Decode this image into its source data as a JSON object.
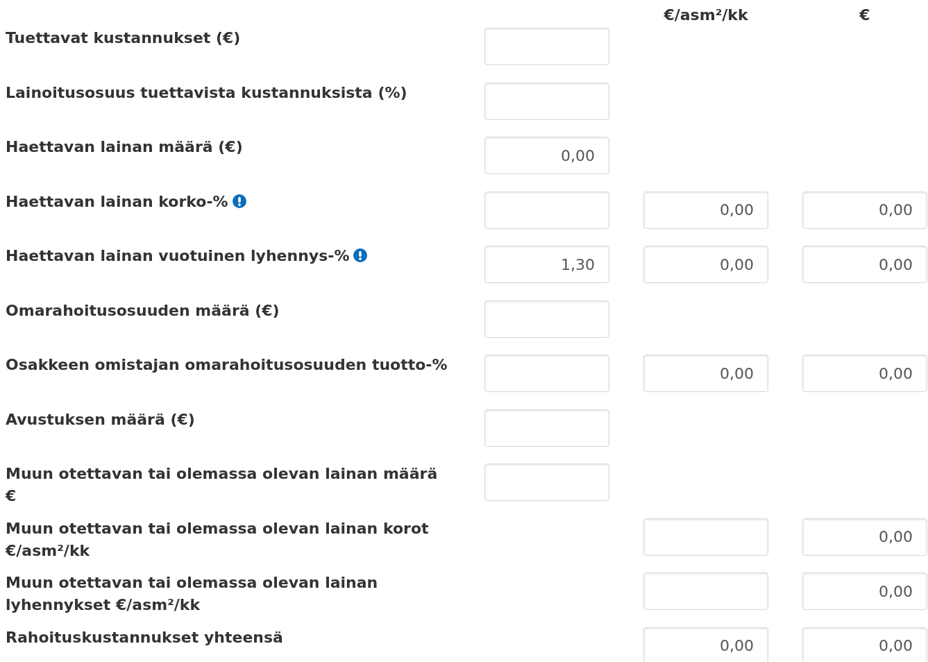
{
  "column_headers": [
    "€/asm²/kk",
    "€"
  ],
  "rows": [
    {
      "label": "Tuettavat kustannukset (€)",
      "notice": false,
      "cells": [
        {
          "kind": "input"
        },
        {
          "kind": "none"
        },
        {
          "kind": "none"
        }
      ]
    },
    {
      "label": "Lainoitusosuus tuettavista kustannuksista (%)",
      "notice": false,
      "cells": [
        {
          "kind": "input"
        },
        {
          "kind": "none"
        },
        {
          "kind": "none"
        }
      ]
    },
    {
      "label": "Haettavan lainan määrä (€)",
      "notice": false,
      "cells": [
        {
          "kind": "input",
          "value": "0,00"
        },
        {
          "kind": "none"
        },
        {
          "kind": "none"
        }
      ]
    },
    {
      "label": "Haettavan lainan korko-%",
      "notice": true,
      "cells": [
        {
          "kind": "input"
        },
        {
          "kind": "input",
          "value": "0,00"
        },
        {
          "kind": "input",
          "value": "0,00"
        }
      ]
    },
    {
      "label": "Haettavan lainan vuotuinen lyhennys-%",
      "notice": true,
      "cells": [
        {
          "kind": "input",
          "value": "1,30"
        },
        {
          "kind": "input",
          "value": "0,00"
        },
        {
          "kind": "input",
          "value": "0,00"
        }
      ]
    },
    {
      "label": "Omarahoitusosuuden määrä (€)",
      "notice": false,
      "cells": [
        {
          "kind": "input"
        },
        {
          "kind": "none"
        },
        {
          "kind": "none"
        }
      ]
    },
    {
      "label": "Osakkeen omistajan omarahoitusosuuden tuotto-%",
      "notice": false,
      "cells": [
        {
          "kind": "input"
        },
        {
          "kind": "input",
          "value": "0,00"
        },
        {
          "kind": "input",
          "value": "0,00"
        }
      ]
    },
    {
      "label": "Avustuksen määrä (€)",
      "notice": false,
      "cells": [
        {
          "kind": "input"
        },
        {
          "kind": "none"
        },
        {
          "kind": "none"
        }
      ]
    },
    {
      "label": "Muun otettavan tai olemassa olevan lainan määrä €",
      "notice": false,
      "cells": [
        {
          "kind": "input"
        },
        {
          "kind": "none"
        },
        {
          "kind": "none"
        }
      ]
    },
    {
      "label": "Muun otettavan tai olemassa olevan lainan korot €/asm²/kk",
      "notice": false,
      "cells": [
        {
          "kind": "none"
        },
        {
          "kind": "input"
        },
        {
          "kind": "input",
          "value": "0,00"
        }
      ]
    },
    {
      "label": "Muun otettavan tai olemassa olevan lainan lyhennykset €/asm²/kk",
      "notice": false,
      "cells": [
        {
          "kind": "none"
        },
        {
          "kind": "input"
        },
        {
          "kind": "input",
          "value": "0,00"
        }
      ]
    },
    {
      "label": "Rahoituskustannukset yhteensä",
      "notice": false,
      "cells": [
        {
          "kind": "none"
        },
        {
          "kind": "input",
          "value": "0,00"
        },
        {
          "kind": "input",
          "value": "0,00"
        }
      ]
    }
  ]
}
